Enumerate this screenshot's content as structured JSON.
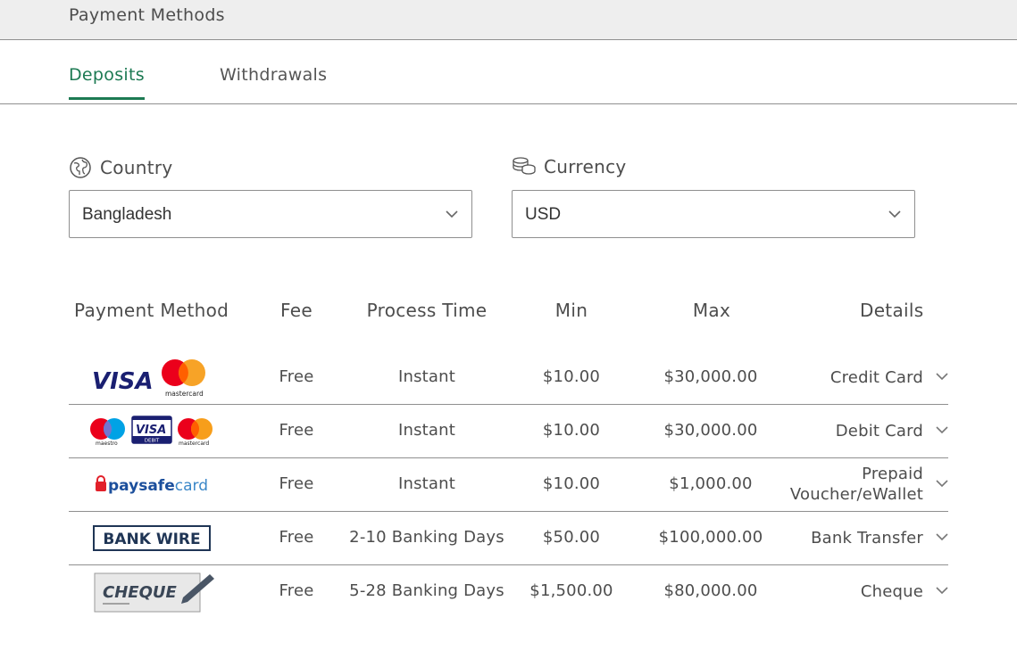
{
  "page_title": "Payment Methods",
  "tabs": [
    {
      "label": "Deposits",
      "active": true
    },
    {
      "label": "Withdrawals",
      "active": false
    }
  ],
  "filters": {
    "country": {
      "label": "Country",
      "value": "Bangladesh",
      "icon": "globe-icon"
    },
    "currency": {
      "label": "Currency",
      "value": "USD",
      "icon": "coins-icon"
    }
  },
  "table": {
    "headers": [
      "Payment Method",
      "Fee",
      "Process Time",
      "Min",
      "Max",
      "Details"
    ],
    "rows": [
      {
        "logo": "visa-mastercard-logo",
        "logo_text": [
          "VISA",
          "mastercard"
        ],
        "fee": "Free",
        "process_time": "Instant",
        "min": "$10.00",
        "max": "$30,000.00",
        "details": "Credit Card"
      },
      {
        "logo": "maestro-visa-debit-mastercard-logo",
        "logo_text": [
          "maestro",
          "VISA",
          "DEBIT",
          "mastercard"
        ],
        "fee": "Free",
        "process_time": "Instant",
        "min": "$10.00",
        "max": "$30,000.00",
        "details": "Debit Card"
      },
      {
        "logo": "paysafecard-logo",
        "logo_text": [
          "paysafecard"
        ],
        "fee": "Free",
        "process_time": "Instant",
        "min": "$10.00",
        "max": "$1,000.00",
        "details": "Prepaid Voucher/eWallet"
      },
      {
        "logo": "bank-wire-logo",
        "logo_text": [
          "BANK WIRE"
        ],
        "fee": "Free",
        "process_time": "2-10 Banking Days",
        "min": "$50.00",
        "max": "$100,000.00",
        "details": "Bank Transfer"
      },
      {
        "logo": "cheque-logo",
        "logo_text": [
          "CHEQUE"
        ],
        "fee": "Free",
        "process_time": "5-28 Banking Days",
        "min": "$1,500.00",
        "max": "$80,000.00",
        "details": "Cheque"
      }
    ]
  },
  "colors": {
    "accent": "#1d7a53",
    "topbar_bg": "#eeeeee",
    "border": "#8f8f8f",
    "visa_blue": "#1a1f71",
    "mastercard_red": "#eb001b",
    "mastercard_orange": "#f79e1b",
    "paysafe_red": "#e2202a",
    "paysafe_blue": "#3b87c8"
  }
}
